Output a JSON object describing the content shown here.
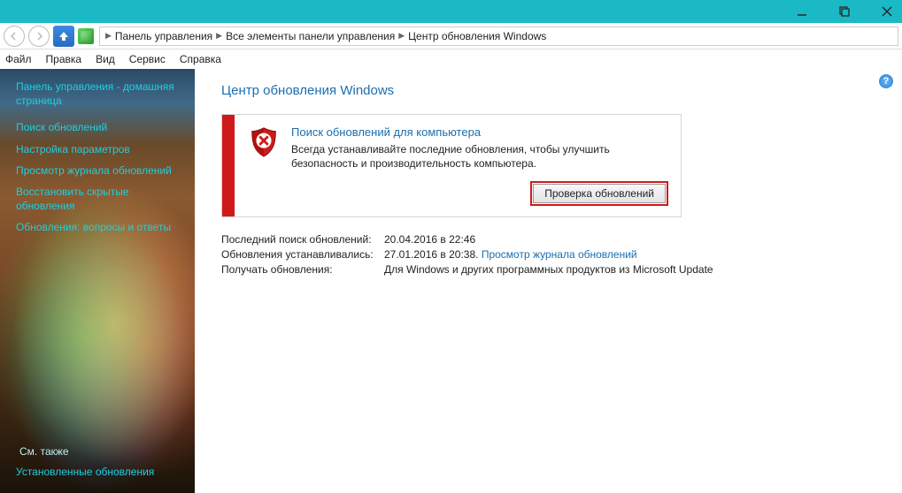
{
  "breadcrumb": {
    "c1": "Панель управления",
    "c2": "Все элементы панели управления",
    "c3": "Центр обновления Windows"
  },
  "menu": {
    "file": "Файл",
    "edit": "Правка",
    "view": "Вид",
    "tools": "Сервис",
    "help": "Справка"
  },
  "sidebar": {
    "home": "Панель управления - домашняя страница",
    "link1": "Поиск обновлений",
    "link2": "Настройка параметров",
    "link3": "Просмотр журнала обновлений",
    "link4": "Восстановить скрытые обновления",
    "link5": "Обновления: вопросы и ответы",
    "section": "См. также",
    "link6": "Установленные обновления"
  },
  "page": {
    "title": "Центр обновления Windows"
  },
  "panel": {
    "heading": "Поиск обновлений для компьютера",
    "desc": "Всегда устанавливайте последние обновления, чтобы улучшить безопасность и производительность компьютера.",
    "button": "Проверка обновлений"
  },
  "info": {
    "l1": "Последний поиск обновлений:",
    "v1": "20.04.2016 в 22:46",
    "l2": "Обновления устанавливались:",
    "v2": "27.01.2016 в 20:38. ",
    "v2link": "Просмотр журнала обновлений",
    "l3": "Получать обновления:",
    "v3": "Для Windows и других программных продуктов из Microsoft Update"
  },
  "help_glyph": "?"
}
